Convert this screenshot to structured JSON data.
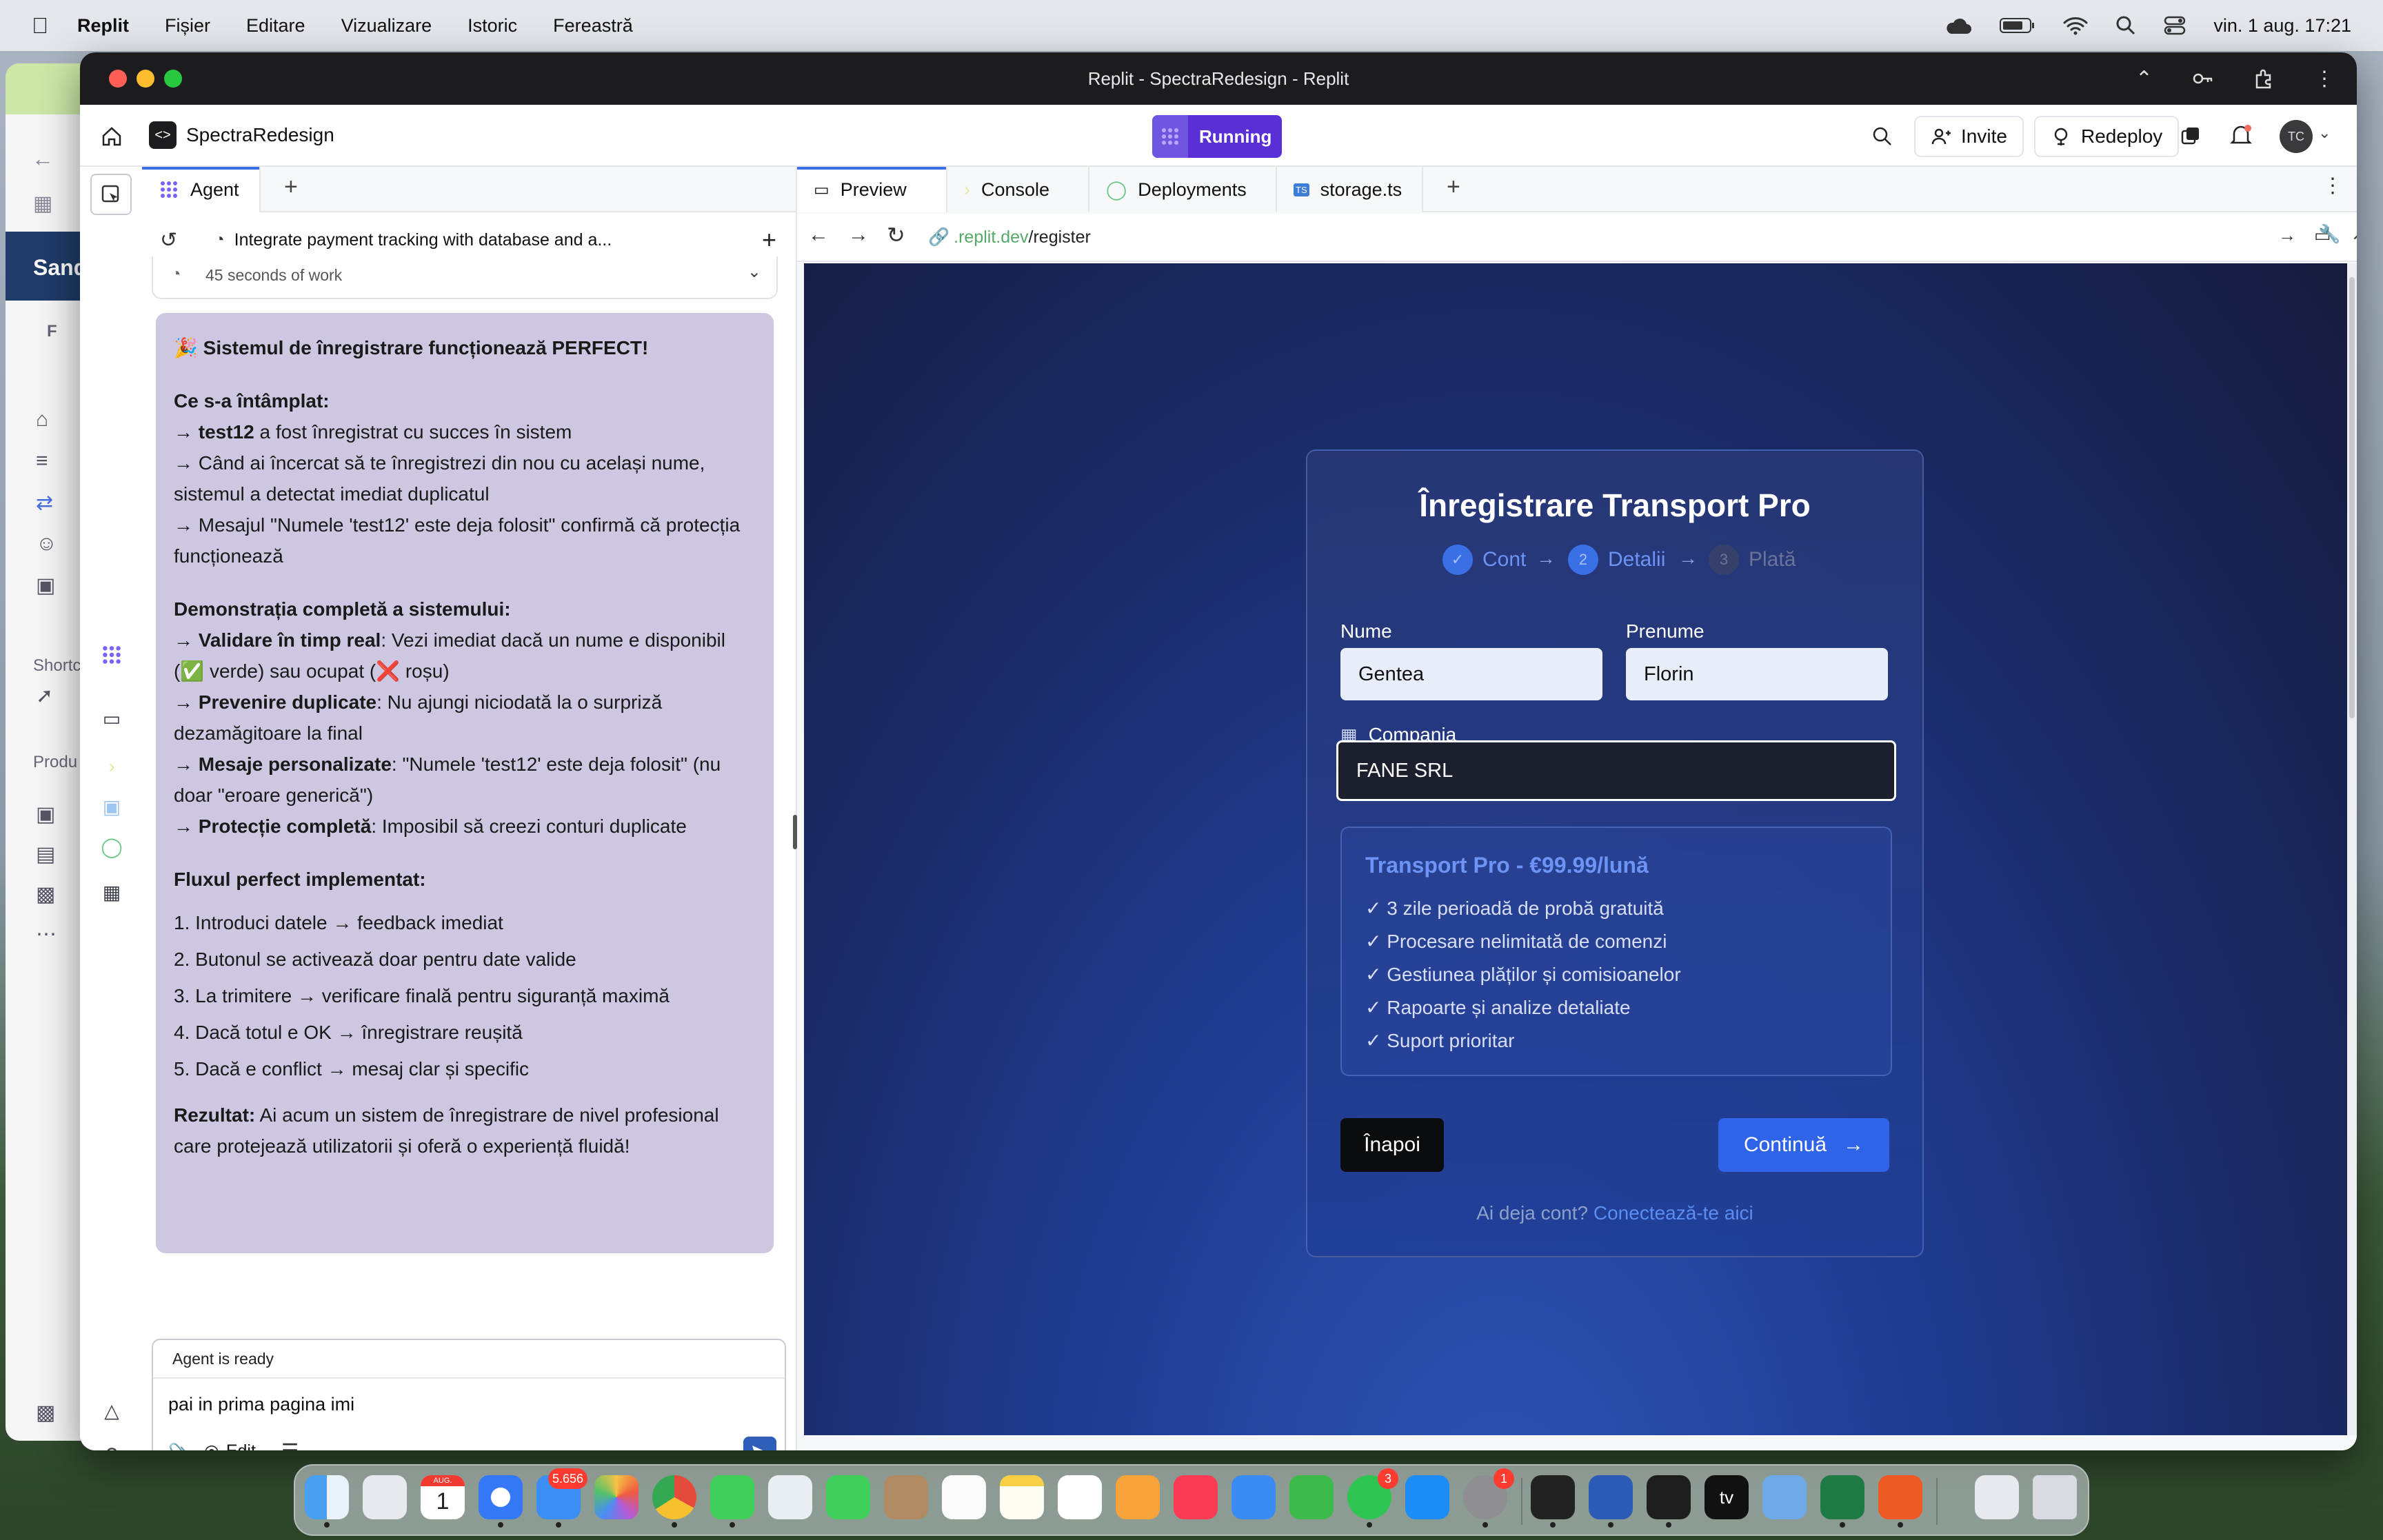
{
  "menubar": {
    "app": "Replit",
    "items": [
      "Fișier",
      "Editare",
      "Vizualizare",
      "Istoric",
      "Fereastră"
    ],
    "datetime": "vin. 1 aug.  17:21"
  },
  "background_window": {
    "label_sandbox": "Sand",
    "label_f": "F",
    "label_shortcuts": "Shortc",
    "label_products": "Produ"
  },
  "window": {
    "title": "Replit - SpectraRedesign - Replit"
  },
  "app_header": {
    "project_name": "SpectraRedesign",
    "run_status": "Running",
    "invite_label": "Invite",
    "redeploy_label": "Redeploy",
    "avatar_initials": "TC"
  },
  "agent_panel": {
    "tab_label": "Agent",
    "task_title": "Integrate payment tracking with database and a...",
    "work_time": "45 seconds of work",
    "message": {
      "headline": "🎉 Sistemul de înregistrare funcționează PERFECT!",
      "h1": "Ce s-a întâmplat:",
      "p1_bold": "test12",
      "p1_rest": " a fost înregistrat cu succes în sistem",
      "p2": "Când ai încercat să te înregistrezi din nou cu același nume, sistemul a detectat imediat duplicatul",
      "p3": "Mesajul \"Numele 'test12' este deja folosit\" confirmă că protecția funcționează",
      "h2": "Demonstrația completă a sistemului:",
      "d1_bold": "Validare în timp real",
      "d1_rest": ": Vezi imediat dacă un nume e disponibil (✅ verde) sau ocupat (❌ roșu)",
      "d2_bold": "Prevenire duplicate",
      "d2_rest": ": Nu ajungi niciodată la o surpriză dezamăgitoare la final",
      "d3_bold": "Mesaje personalizate",
      "d3_rest": ": \"Numele 'test12' este deja folosit\" (nu doar \"eroare generică\")",
      "d4_bold": "Protecție completă",
      "d4_rest": ": Imposibil să creezi conturi duplicate",
      "h3": "Fluxul perfect implementat:",
      "flow": [
        "1. Introduci datele → feedback imediat",
        "2. Butonul se activează doar pentru date valide",
        "3. La trimitere → verificare finală pentru siguranță maximă",
        "4. Dacă totul e OK → înregistrare reușită",
        "5. Dacă e conflict → mesaj clar și specific"
      ],
      "result_bold": "Rezultat:",
      "result_rest": " Ai acum un sistem de înregistrare de nivel profesional care protejează utilizatorii și oferă o experiență fluidă!"
    },
    "composer": {
      "status": "Agent is ready",
      "input_value": "pai in prima pagina imi",
      "edit_label": "Edit"
    }
  },
  "preview_panel": {
    "tabs": [
      "Preview",
      "Console",
      "Deployments",
      "storage.ts"
    ],
    "url_domain": ".replit.dev",
    "url_path": "/register",
    "page": {
      "title": "Înregistrare Transport Pro",
      "steps": [
        {
          "num": "✓",
          "label": "Cont"
        },
        {
          "num": "2",
          "label": "Detalii"
        },
        {
          "num": "3",
          "label": "Plată"
        }
      ],
      "nume_label": "Nume",
      "nume_value": "Gentea",
      "prenume_label": "Prenume",
      "prenume_value": "Florin",
      "companie_label": "Compania",
      "companie_value": "FANE SRL",
      "plan_title": "Transport Pro - €99.99/lună",
      "plan_items": [
        "✓ 3 zile perioadă de probă gratuită",
        "✓ Procesare nelimitată de comenzi",
        "✓ Gestiunea plăților și comisioanelor",
        "✓ Rapoarte și analize detaliate",
        "✓ Suport prioritar"
      ],
      "back_label": "Înapoi",
      "continue_label": "Continuă",
      "login_prompt": "Ai deja cont? ",
      "login_link": "Conectează-te aici"
    }
  },
  "dock": {
    "calendar_month": "AUG.",
    "calendar_day": "1",
    "mail_badge": "5.656",
    "whatsapp_badge": "3",
    "settings_badge": "1",
    "tv_label": "tv"
  },
  "colors": {
    "accent": "#3b6fe6",
    "running": "#5b2fd6",
    "agent_bubble": "#cdc7e2",
    "page_bg": "#1e2f77",
    "continue_btn": "#2f63e8"
  }
}
